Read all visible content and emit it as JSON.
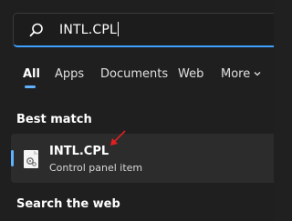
{
  "search": {
    "value": "INTL.CPL",
    "icon": "search-icon"
  },
  "tabs": [
    {
      "label": "All",
      "active": true
    },
    {
      "label": "Apps",
      "active": false
    },
    {
      "label": "Documents",
      "active": false
    },
    {
      "label": "Web",
      "active": false
    },
    {
      "label": "More",
      "active": false
    }
  ],
  "best_match": {
    "title": "Best match",
    "result": {
      "name": "INTL.CPL",
      "subtitle": "Control panel item",
      "icon": "control-panel-file-icon"
    }
  },
  "web_section": {
    "title": "Search the web"
  },
  "colors": {
    "accent": "#5fb2ff",
    "annotation_arrow": "#e02020",
    "background": "#1f1f1f",
    "card": "#2c2c2c"
  }
}
